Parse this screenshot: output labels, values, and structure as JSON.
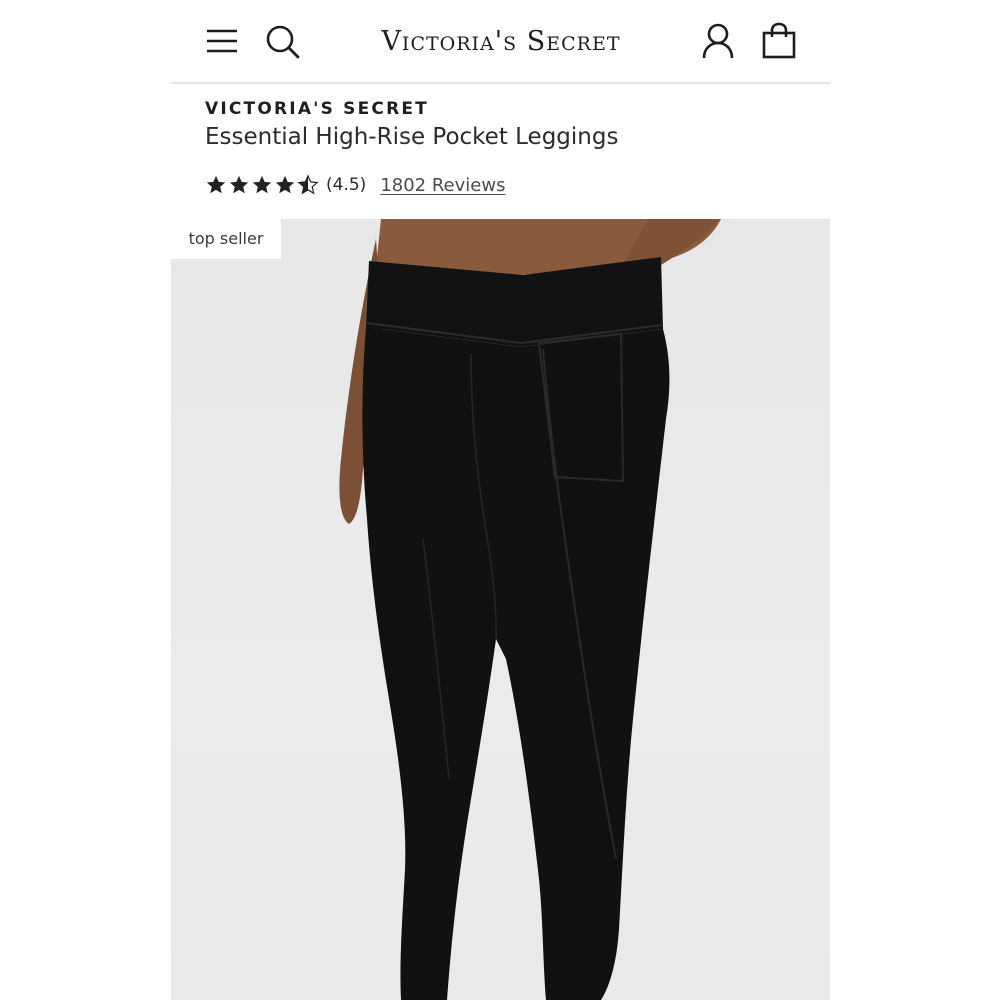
{
  "header": {
    "logo_text": "Victoria's Secret",
    "icons": [
      "menu-icon",
      "search-icon",
      "account-icon",
      "shopping-bag-icon"
    ]
  },
  "product": {
    "brand": "VICTORIA'S SECRET",
    "title": "Essential High-Rise Pocket Leggings",
    "rating": 4.5,
    "rating_text": "(4.5)",
    "reviews_text": "1802 Reviews",
    "badge": "top seller"
  },
  "colors": {
    "text": "#1f1f1f",
    "image_background": "#e9e9e9",
    "leggings": "#111111",
    "skin": "#8a5a3c"
  }
}
